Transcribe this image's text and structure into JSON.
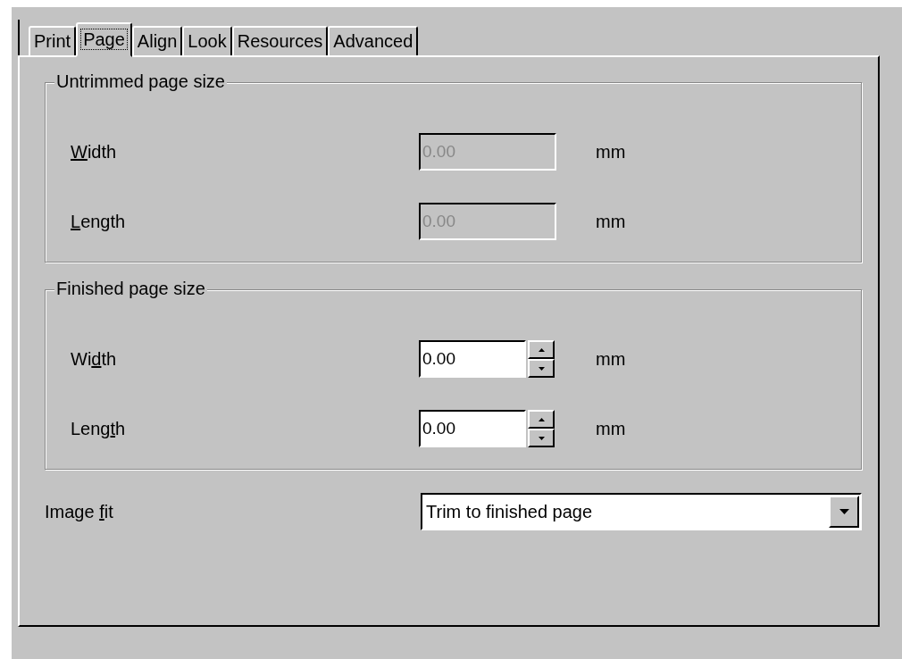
{
  "tabs": [
    {
      "label": "Print",
      "selected": false
    },
    {
      "label": "Page",
      "selected": true
    },
    {
      "label": "Align",
      "selected": false
    },
    {
      "label": "Look",
      "selected": false
    },
    {
      "label": "Resources",
      "selected": false
    },
    {
      "label": "Advanced",
      "selected": false
    }
  ],
  "groups": [
    {
      "title": "Untrimmed page size",
      "rows": [
        {
          "label": {
            "key": "W",
            "post": "idth"
          },
          "kind": "text",
          "value": "0.00",
          "disabled": true,
          "unit": "mm"
        },
        {
          "label": {
            "key": "L",
            "post": "ength"
          },
          "kind": "text",
          "value": "0.00",
          "disabled": true,
          "unit": "mm"
        }
      ]
    },
    {
      "title": "Finished page size",
      "rows": [
        {
          "label": {
            "pre": "Wi",
            "key": "d",
            "post": "th"
          },
          "kind": "spin",
          "value": "0.00",
          "disabled": false,
          "unit": "mm"
        },
        {
          "label": {
            "pre": "Leng",
            "key": "t",
            "post": "h"
          },
          "kind": "spin",
          "value": "0.00",
          "disabled": false,
          "unit": "mm"
        }
      ]
    }
  ],
  "image_fit": {
    "label": {
      "pre": "Image ",
      "key": "f",
      "post": "it"
    },
    "value": "Trim to finished page"
  }
}
